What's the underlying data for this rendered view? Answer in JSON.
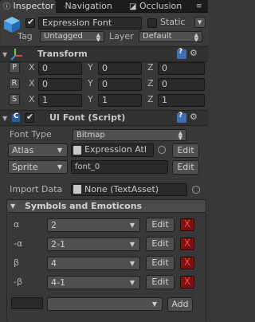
{
  "tabs": [
    {
      "label": "Inspector",
      "icon": "info-icon"
    },
    {
      "label": "Navigation",
      "icon": "navigation-icon"
    },
    {
      "label": "Occlusion",
      "icon": "occlusion-icon"
    }
  ],
  "gameobject": {
    "name": "Expression Font",
    "active": true,
    "static_label": "Static",
    "tag_label": "Tag",
    "tag_value": "Untagged",
    "layer_label": "Layer",
    "layer_value": "Default"
  },
  "transform": {
    "title": "Transform",
    "rows": [
      {
        "btn": "P",
        "x": "0",
        "y": "0",
        "z": "0"
      },
      {
        "btn": "R",
        "x": "0",
        "y": "0",
        "z": "0"
      },
      {
        "btn": "S",
        "x": "1",
        "y": "1",
        "z": "1"
      }
    ],
    "x_label": "X",
    "y_label": "Y",
    "z_label": "Z"
  },
  "uifont": {
    "title": "UI Font (Script)",
    "font_type_label": "Font Type",
    "font_type_value": "Bitmap",
    "atlas_label": "Atlas",
    "atlas_value": "Expression Atl",
    "sprite_label": "Sprite",
    "sprite_value": "font_0",
    "edit_label": "Edit",
    "import_label": "Import Data",
    "import_value": "None (TextAsset)"
  },
  "symbols": {
    "title": "Symbols and Emoticons",
    "rows": [
      {
        "symbol": "α",
        "value": "2"
      },
      {
        "symbol": "-α",
        "value": "2-1"
      },
      {
        "symbol": "β",
        "value": "4"
      },
      {
        "symbol": "-β",
        "value": "4-1"
      }
    ],
    "edit_label": "Edit",
    "remove_label": "X",
    "add_label": "Add"
  }
}
